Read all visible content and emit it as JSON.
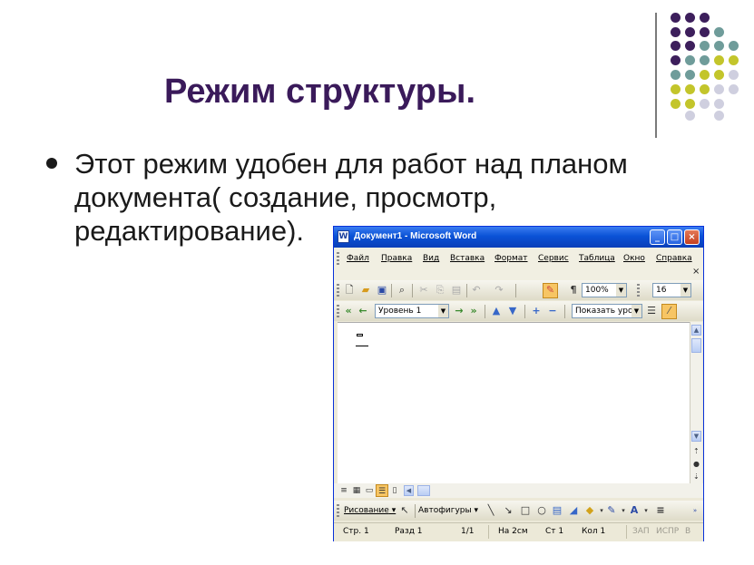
{
  "slide": {
    "title": "Режим структуры.",
    "bullet_lines": [
      "Этот режим удобен для работ над планом",
      "документа( создание, просмотр,",
      "редактирование)."
    ],
    "colors": {
      "title": "#3a1a5a",
      "dot_purple": "#3d1f5c",
      "dot_teal": "#6f9c9a",
      "dot_olive": "#c3c52b",
      "dot_grey": "#cfcfdf"
    }
  },
  "word": {
    "title": "Документ1 - Microsoft Word",
    "app_icon": "W",
    "window_buttons": {
      "minimize": "_",
      "maximize": "□",
      "close": "×"
    },
    "menu": [
      "Файл",
      "Правка",
      "Вид",
      "Вставка",
      "Формат",
      "Сервис",
      "Таблица",
      "Окно",
      "Справка"
    ],
    "doc_close": "×",
    "standard_toolbar": {
      "icons": [
        "new-icon",
        "open-icon",
        "save-icon",
        "print-preview-icon",
        "cut-icon",
        "copy-icon",
        "paste-icon",
        "undo-icon",
        "redo-icon",
        "drawing-toggle-icon",
        "show-marks-icon"
      ],
      "show_marks_glyph": "¶",
      "zoom": "100%",
      "font_size": "16"
    },
    "outline_toolbar": {
      "level": "Уровень 1",
      "show_level": "Показать уров"
    },
    "drawing_toolbar": {
      "draw_label": "Рисование",
      "autoshapes_label": "Автофигуры"
    },
    "status": {
      "page": "Стр. 1",
      "section": "Разд 1",
      "pages": "1/1",
      "at": "На 2см",
      "line": "Ст 1",
      "col": "Кол 1",
      "rec": "ЗАП",
      "trk": "ИСПР",
      "ext": "В"
    }
  }
}
